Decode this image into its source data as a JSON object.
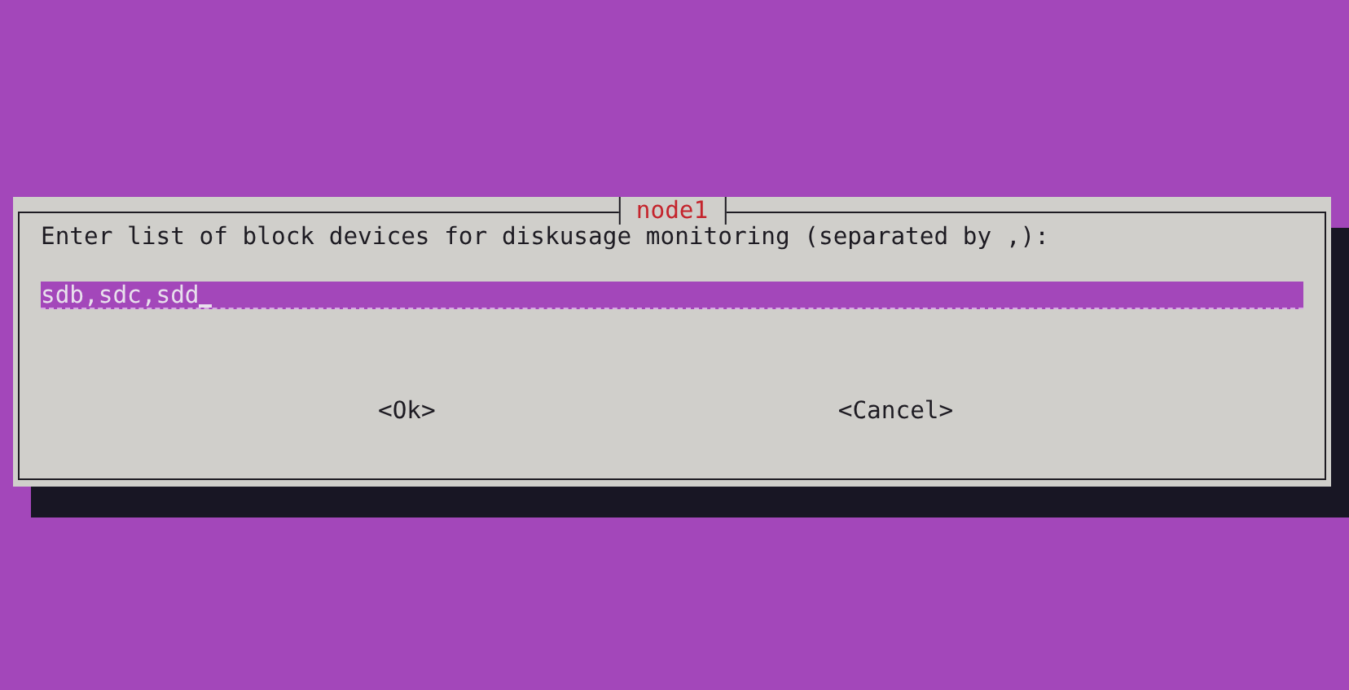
{
  "dialog": {
    "title": "node1",
    "prompt": "Enter list of block devices for diskusage monitoring (separated by ,):",
    "input": {
      "value": "sdb,sdc,sdd"
    },
    "buttons": [
      {
        "label": "<Ok>"
      },
      {
        "label": "<Cancel>"
      }
    ]
  }
}
